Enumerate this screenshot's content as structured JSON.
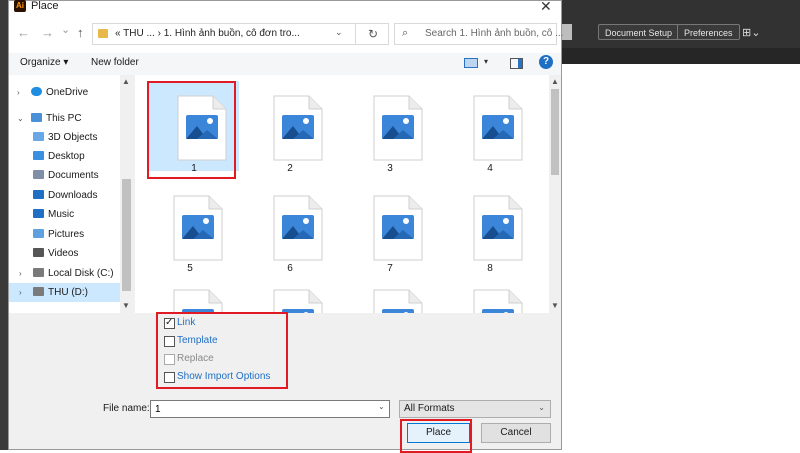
{
  "app": {
    "toolbar_buttons": [
      "Document Setup",
      "Preferences"
    ]
  },
  "dialog": {
    "app_icon_text": "Ai",
    "title": "Place",
    "close_glyph": "✕",
    "nav": {
      "back": "←",
      "forward": "→",
      "recent": "⌄",
      "up": "↑"
    },
    "address": {
      "text": "« THU ...  ›  1. Hình ảnh buồn, cô đơn tro...",
      "dropdown": "⌄",
      "refresh": "↻"
    },
    "search": {
      "placeholder": "Search 1. Hình ảnh buồn, cô ...",
      "icon": "search-icon"
    },
    "commands": {
      "organize": "Organize ▾",
      "new_folder": "New folder",
      "help": "?"
    },
    "nav_pane": {
      "items": [
        {
          "label": "OneDrive",
          "icon": "cloud-icon",
          "color": "#1f8ee0"
        },
        {
          "label": "This PC",
          "icon": "computer-icon",
          "color": "#4a90d9"
        },
        {
          "label": "3D Objects",
          "icon": "cube-icon",
          "color": "#6aa7e6"
        },
        {
          "label": "Desktop",
          "icon": "desktop-icon",
          "color": "#3b8fe0"
        },
        {
          "label": "Documents",
          "icon": "document-icon",
          "color": "#7f8fa8"
        },
        {
          "label": "Downloads",
          "icon": "download-icon",
          "color": "#1f6fc5"
        },
        {
          "label": "Music",
          "icon": "music-icon",
          "color": "#1f6fc5"
        },
        {
          "label": "Pictures",
          "icon": "pictures-icon",
          "color": "#5fa0e0"
        },
        {
          "label": "Videos",
          "icon": "video-icon",
          "color": "#555555"
        },
        {
          "label": "Local Disk (C:)",
          "icon": "drive-icon",
          "color": "#7a7a7a"
        },
        {
          "label": "THU (D:)",
          "icon": "drive-icon",
          "color": "#7a7a7a"
        }
      ],
      "selected": "THU (D:)"
    },
    "files": [
      {
        "label": "1",
        "selected": true
      },
      {
        "label": "2",
        "selected": false
      },
      {
        "label": "3",
        "selected": false
      },
      {
        "label": "4",
        "selected": false
      },
      {
        "label": "5",
        "selected": false
      },
      {
        "label": "6",
        "selected": false
      },
      {
        "label": "7",
        "selected": false
      },
      {
        "label": "8",
        "selected": false
      },
      {
        "label": "",
        "selected": false
      },
      {
        "label": "",
        "selected": false
      },
      {
        "label": "",
        "selected": false
      },
      {
        "label": "",
        "selected": false
      }
    ],
    "options": {
      "link": {
        "label": "Link",
        "checked": true
      },
      "template": {
        "label": "Template",
        "checked": false
      },
      "replace": {
        "label": "Replace",
        "checked": false,
        "disabled": true
      },
      "show_import": {
        "label": "Show Import Options",
        "checked": false
      }
    },
    "file_name_label": "File name:",
    "file_name_value": "1",
    "format": "All Formats",
    "place_label": "Place",
    "cancel_label": "Cancel",
    "highlight_color": "#e01b24",
    "accent_color": "#1f6fc5"
  }
}
